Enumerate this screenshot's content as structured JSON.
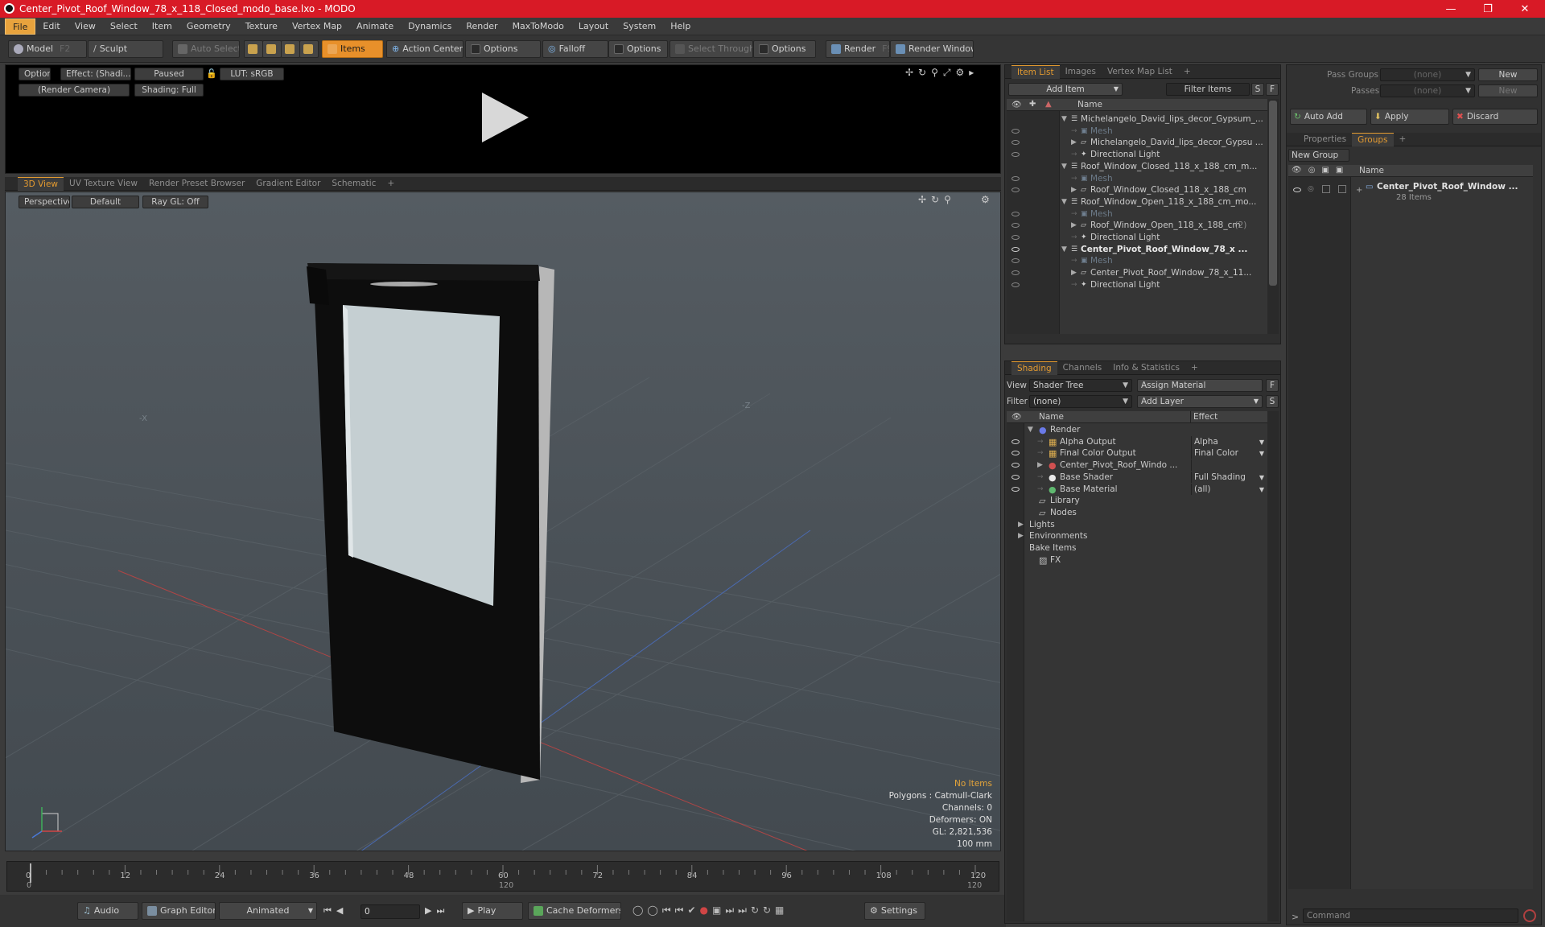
{
  "window": {
    "title": "Center_Pivot_Roof_Window_78_x_118_Closed_modo_base.lxo - MODO",
    "minimize": "—",
    "maximize": "❐",
    "close": "✕"
  },
  "menu": [
    "File",
    "Edit",
    "View",
    "Select",
    "Item",
    "Geometry",
    "Texture",
    "Vertex Map",
    "Animate",
    "Dynamics",
    "Render",
    "MaxToModo",
    "Layout",
    "System",
    "Help"
  ],
  "toolbar": {
    "model": "Model",
    "model_key": "F2",
    "sculpt": "Sculpt",
    "auto_select": "Auto Select",
    "items": "Items",
    "action_center": "Action Center",
    "options1": "Options",
    "falloff": "Falloff",
    "options2": "Options",
    "select_through": "Select Through",
    "options3": "Options",
    "render": "Render",
    "render_key": "F9",
    "render_window": "Render Window"
  },
  "preview": {
    "options": "Options",
    "effect": "Effect: (Shadi...",
    "paused": "Paused",
    "lut": "LUT: sRGB",
    "camera": "(Render Camera)",
    "shading": "Shading: Full"
  },
  "viewport_tabs": [
    "3D View",
    "UV Texture View",
    "Render Preset Browser",
    "Gradient Editor",
    "Schematic",
    "+"
  ],
  "viewport": {
    "perspective": "Perspective",
    "default": "Default",
    "raygl": "Ray GL: Off",
    "axis_x": "-X",
    "axis_z": "-Z",
    "stats": {
      "no_items": "No Items",
      "polygons": "Polygons : Catmull-Clark",
      "channels": "Channels: 0",
      "deformers": "Deformers: ON",
      "gl": "GL: 2,821,536",
      "unit": "100 mm"
    }
  },
  "timeline": {
    "ticks": [
      "0",
      "12",
      "24",
      "36",
      "48",
      "60",
      "72",
      "84",
      "96",
      "108",
      "120"
    ],
    "start": "0",
    "mid": "120",
    "end": "120"
  },
  "transport": {
    "audio": "Audio",
    "graph_editor": "Graph Editor",
    "animated": "Animated",
    "frame": "0",
    "play": "Play",
    "cache_deformers": "Cache Deformers",
    "settings": "Settings"
  },
  "itemlist": {
    "tabs": [
      "Item List",
      "Images",
      "Vertex Map List",
      "+"
    ],
    "add_item": "Add Item",
    "filter_items": "Filter Items",
    "s": "S",
    "f": "F",
    "col_name": "Name",
    "rows": [
      {
        "label": "Michelangelo_David_lips_decor_Gypsum_...",
        "indent": 0,
        "type": "scene",
        "expand": "down",
        "dim": false,
        "bold": false,
        "eye": false
      },
      {
        "label": "Mesh",
        "indent": 1,
        "type": "mesh",
        "expand": "",
        "dim": true,
        "bold": false,
        "eye": true
      },
      {
        "label": "Michelangelo_David_lips_decor_Gypsu ...",
        "indent": 1,
        "type": "locator",
        "expand": "right",
        "dim": false,
        "bold": false,
        "eye": true
      },
      {
        "label": "Directional Light",
        "indent": 1,
        "type": "light",
        "expand": "",
        "dim": false,
        "bold": false,
        "eye": true
      },
      {
        "label": "Roof_Window_Closed_118_x_188_cm_m...",
        "indent": 0,
        "type": "scene",
        "expand": "down",
        "dim": false,
        "bold": false,
        "eye": false
      },
      {
        "label": "Mesh",
        "indent": 1,
        "type": "mesh",
        "expand": "",
        "dim": true,
        "bold": false,
        "eye": true
      },
      {
        "label": "Roof_Window_Closed_118_x_188_cm",
        "indent": 1,
        "type": "locator",
        "expand": "right",
        "dim": false,
        "bold": false,
        "eye": true
      },
      {
        "label": "Roof_Window_Open_118_x_188_cm_mo...",
        "indent": 0,
        "type": "scene",
        "expand": "down",
        "dim": false,
        "bold": false,
        "eye": false
      },
      {
        "label": "Mesh",
        "indent": 1,
        "type": "mesh",
        "expand": "",
        "dim": true,
        "bold": false,
        "eye": true
      },
      {
        "label": "Roof_Window_Open_118_x_188_cm",
        "indent": 1,
        "type": "locator",
        "expand": "right",
        "dim": false,
        "bold": false,
        "eye": true,
        "suffix": "(2)"
      },
      {
        "label": "Directional Light",
        "indent": 1,
        "type": "light",
        "expand": "",
        "dim": false,
        "bold": false,
        "eye": true
      },
      {
        "label": "Center_Pivot_Roof_Window_78_x ...",
        "indent": 0,
        "type": "scene",
        "expand": "down",
        "dim": false,
        "bold": true,
        "eye": true
      },
      {
        "label": "Mesh",
        "indent": 1,
        "type": "mesh",
        "expand": "",
        "dim": true,
        "bold": false,
        "eye": true
      },
      {
        "label": "Center_Pivot_Roof_Window_78_x_11...",
        "indent": 1,
        "type": "locator",
        "expand": "right",
        "dim": false,
        "bold": false,
        "eye": true
      },
      {
        "label": "Directional Light",
        "indent": 1,
        "type": "light",
        "expand": "",
        "dim": false,
        "bold": false,
        "eye": true
      }
    ]
  },
  "shading": {
    "tabs": [
      "Shading",
      "Channels",
      "Info & Statistics",
      "+"
    ],
    "view_label": "View",
    "view_value": "Shader Tree",
    "assign_material": "Assign Material",
    "filter_label": "Filter",
    "filter_value": "(none)",
    "add_layer": "Add Layer",
    "f": "F",
    "s": "S",
    "col_name": "Name",
    "col_effect": "Effect",
    "rows": [
      {
        "label": "Render",
        "effect": "",
        "indent": 0,
        "icon": "render",
        "expand": "down",
        "eye": false
      },
      {
        "label": "Alpha Output",
        "effect": "Alpha",
        "indent": 1,
        "icon": "output",
        "expand": "",
        "eye": true
      },
      {
        "label": "Final Color Output",
        "effect": "Final Color",
        "indent": 1,
        "icon": "output",
        "expand": "",
        "eye": true
      },
      {
        "label": "Center_Pivot_Roof_Windo ...",
        "effect": "",
        "indent": 1,
        "icon": "material",
        "expand": "right",
        "eye": true
      },
      {
        "label": "Base Shader",
        "effect": "Full Shading",
        "indent": 1,
        "icon": "shader",
        "expand": "",
        "eye": true
      },
      {
        "label": "Base Material",
        "effect": "(all)",
        "indent": 1,
        "icon": "basemat",
        "expand": "",
        "eye": true
      },
      {
        "label": "Library",
        "effect": "",
        "indent": 0,
        "icon": "folder",
        "expand": "",
        "eye": false
      },
      {
        "label": "Nodes",
        "effect": "",
        "indent": 0,
        "icon": "folder",
        "expand": "",
        "eye": false
      },
      {
        "label": "Lights",
        "effect": "",
        "indent": -1,
        "icon": "",
        "expand": "right",
        "eye": false
      },
      {
        "label": "Environments",
        "effect": "",
        "indent": -1,
        "icon": "",
        "expand": "right",
        "eye": false
      },
      {
        "label": "Bake Items",
        "effect": "",
        "indent": -1,
        "icon": "",
        "expand": "",
        "eye": false
      },
      {
        "label": "FX",
        "effect": "",
        "indent": 0,
        "icon": "fx",
        "expand": "",
        "eye": false
      }
    ]
  },
  "right": {
    "pass_groups_label": "Pass Groups",
    "pass_groups_value": "(none)",
    "passes_label": "Passes",
    "passes_value": "(none)",
    "new1": "New",
    "new2": "New",
    "auto_add": "Auto Add",
    "apply": "Apply",
    "discard": "Discard",
    "tabs": [
      "Properties",
      "Groups",
      "+"
    ],
    "new_group": "New Group",
    "col_name": "Name",
    "group_name": "Center_Pivot_Roof_Window ...",
    "group_count": "28 Items",
    "command_placeholder": "Command"
  }
}
